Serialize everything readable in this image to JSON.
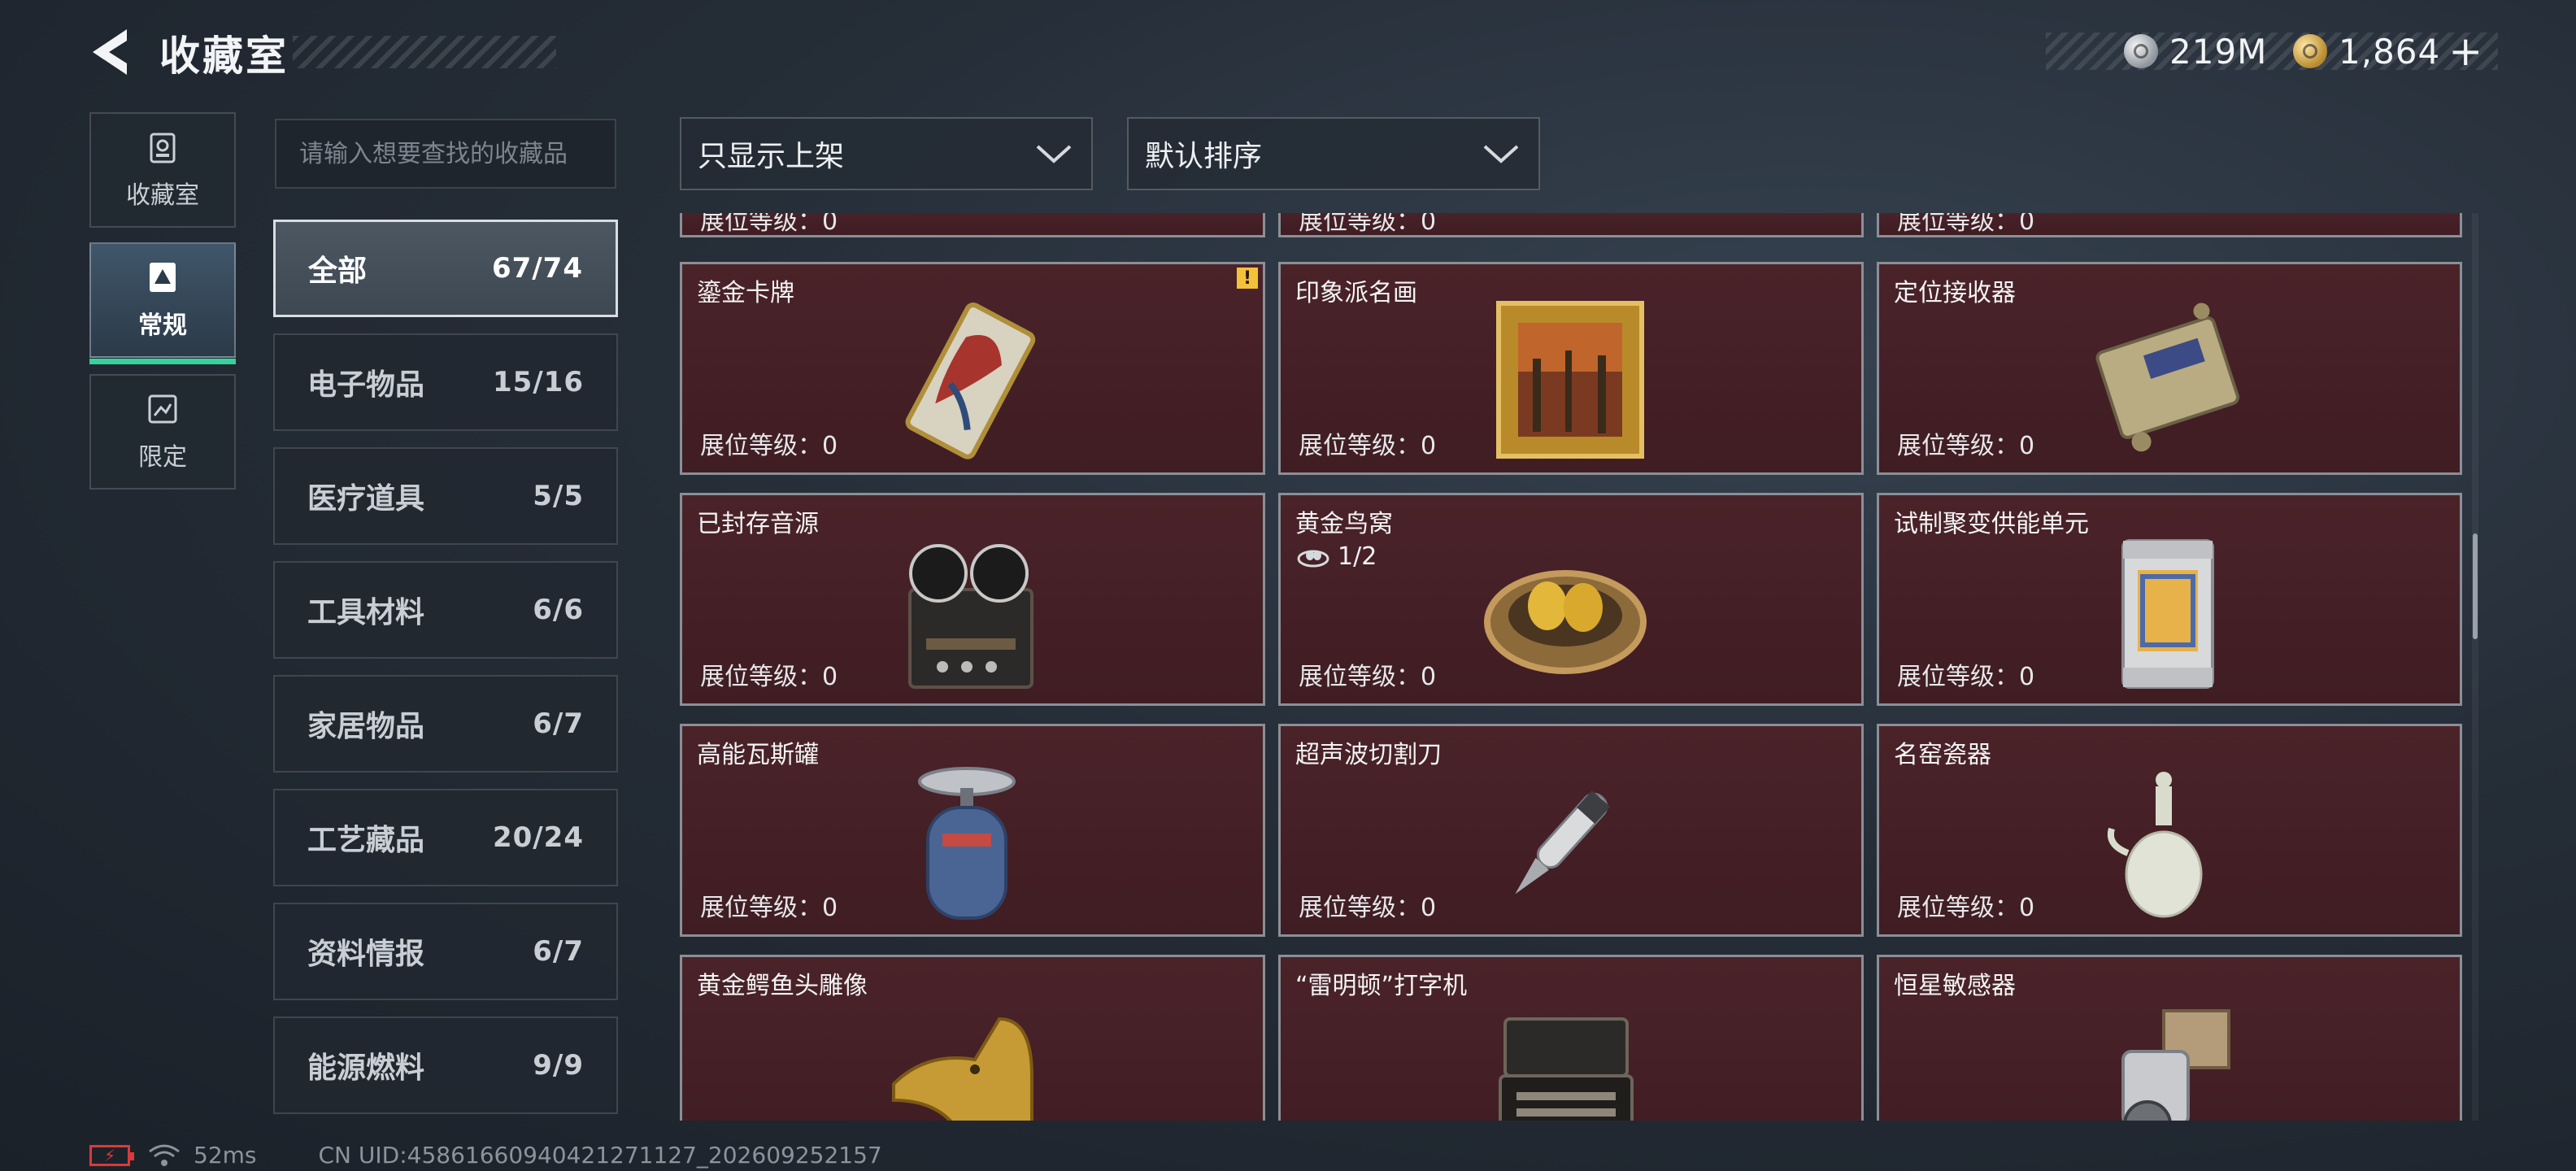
{
  "header": {
    "title": "收藏室",
    "currencies": [
      {
        "icon": "silver-coin-icon",
        "value": "219M"
      },
      {
        "icon": "gold-coin-icon",
        "value": "1,864"
      }
    ],
    "add_label": "+"
  },
  "nav": [
    {
      "label": "收藏室",
      "icon": "collection-room-icon",
      "active": false
    },
    {
      "label": "常规",
      "icon": "regular-icon",
      "active": true
    },
    {
      "label": "限定",
      "icon": "limited-icon",
      "active": false
    }
  ],
  "search": {
    "placeholder": "请输入想要查找的收藏品",
    "value": ""
  },
  "filters": {
    "display_filter": "只显示上架",
    "sort": "默认排序"
  },
  "categories": [
    {
      "name": "全部",
      "count": "67/74",
      "active": true
    },
    {
      "name": "电子物品",
      "count": "15/16",
      "active": false
    },
    {
      "name": "医疗道具",
      "count": "5/5",
      "active": false
    },
    {
      "name": "工具材料",
      "count": "6/6",
      "active": false
    },
    {
      "name": "家居物品",
      "count": "6/7",
      "active": false
    },
    {
      "name": "工艺藏品",
      "count": "20/24",
      "active": false
    },
    {
      "name": "资料情报",
      "count": "6/7",
      "active": false
    },
    {
      "name": "能源燃料",
      "count": "9/9",
      "active": false
    }
  ],
  "level_label": "展位等级：0",
  "items_partial_top": [
    {
      "level": "展位等级：0"
    },
    {
      "level": "展位等级：0"
    },
    {
      "level": "展位等级：0"
    }
  ],
  "items": [
    {
      "name": "鎏金卡牌",
      "level": "展位等级：0",
      "badge": "!",
      "icon": "gilded-card-icon"
    },
    {
      "name": "印象派名画",
      "level": "展位等级：0",
      "icon": "impressionist-painting-icon"
    },
    {
      "name": "定位接收器",
      "level": "展位等级：0",
      "icon": "locator-receiver-icon"
    },
    {
      "name": "已封存音源",
      "level": "展位等级：0",
      "icon": "reel-recorder-icon"
    },
    {
      "name": "黄金鸟窝",
      "level": "展位等级：0",
      "progress": "1/2",
      "icon": "golden-nest-icon"
    },
    {
      "name": "试制聚变供能单元",
      "level": "展位等级：0",
      "icon": "fusion-unit-icon"
    },
    {
      "name": "高能瓦斯罐",
      "level": "展位等级：0",
      "icon": "gas-tank-icon"
    },
    {
      "name": "超声波切割刀",
      "level": "展位等级：0",
      "icon": "ultrasonic-cutter-icon"
    },
    {
      "name": "名窑瓷器",
      "level": "展位等级：0",
      "icon": "porcelain-vase-icon"
    },
    {
      "name": "黄金鳄鱼头雕像",
      "icon": "golden-crocodile-statue-icon"
    },
    {
      "name": "“雷明顿”打字机",
      "icon": "typewriter-icon"
    },
    {
      "name": "恒星敏感器",
      "icon": "star-sensor-icon"
    }
  ],
  "status_bar": {
    "battery_icon": "low-battery-icon",
    "ping": "52ms",
    "uid": "CN UID:4586166094042127112​7_202609252157"
  },
  "colors": {
    "card_bg": "#46212a",
    "accent_green": "#35d29c",
    "badge_yellow": "#f4c23a"
  }
}
